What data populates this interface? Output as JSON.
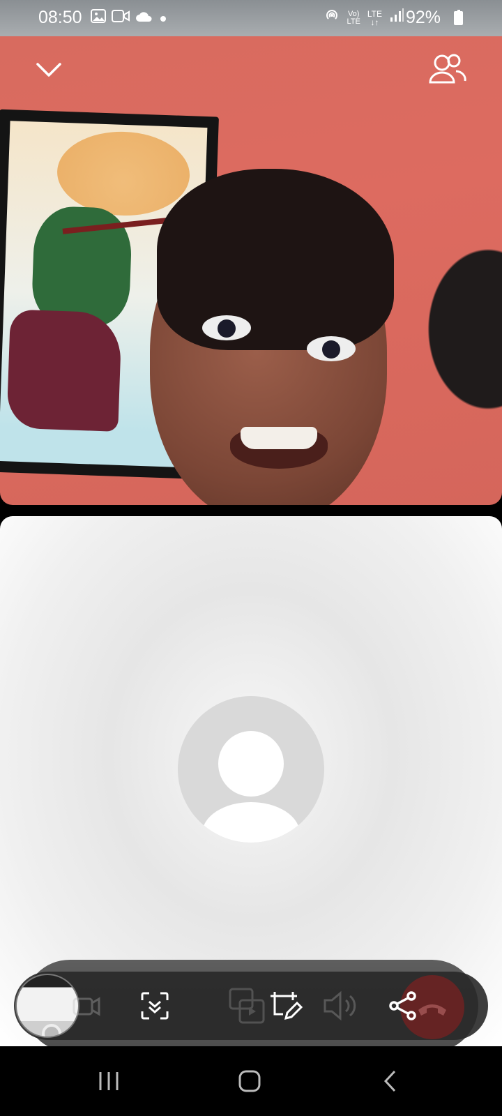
{
  "status_bar": {
    "time": "08:50",
    "battery": "92%",
    "left_icons": [
      "image-icon",
      "video-icon",
      "cloud-icon",
      "dot-icon"
    ],
    "right_icons": [
      "hotspot-icon",
      "volte-icon",
      "lte-icon",
      "signal-icon",
      "battery-icon"
    ]
  },
  "call": {
    "top_left_icon": "chevron-down-icon",
    "top_right_icon": "participants-icon"
  },
  "controls": {
    "buttons": [
      "self-view-thumbnail",
      "camera-off-icon",
      "scan-icon",
      "screen-share-icon",
      "edit-frame-icon",
      "speaker-icon",
      "share-icon",
      "end-call-icon"
    ]
  },
  "navigation": {
    "buttons": [
      "recents-icon",
      "home-icon",
      "back-icon"
    ]
  }
}
